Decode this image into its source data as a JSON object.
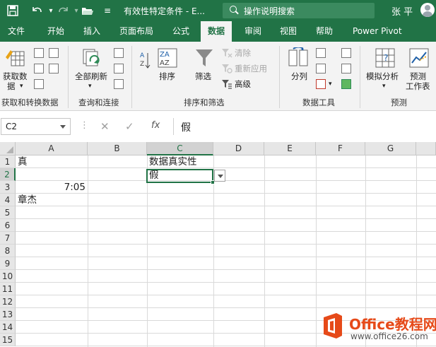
{
  "window": {
    "title": "有效性特定条件 - E...",
    "tell_me": "操作说明搜索",
    "user": "张 平"
  },
  "tabs": [
    {
      "label": "文件"
    },
    {
      "label": "开始"
    },
    {
      "label": "插入"
    },
    {
      "label": "页面布局"
    },
    {
      "label": "公式"
    },
    {
      "label": "数据",
      "active": true
    },
    {
      "label": "审阅"
    },
    {
      "label": "视图"
    },
    {
      "label": "帮助"
    },
    {
      "label": "Power Pivot"
    }
  ],
  "ribbon": {
    "get_data": {
      "label1": "获取数",
      "label2": "据"
    },
    "refresh_all": {
      "label": "全部刷新"
    },
    "sort": {
      "label": "排序"
    },
    "filter": {
      "label": "筛选"
    },
    "clear": {
      "label": "清除"
    },
    "reapply": {
      "label": "重新应用"
    },
    "advanced": {
      "label": "高级"
    },
    "text_to_columns": {
      "label": "分列"
    },
    "what_if": {
      "label": "模拟分析"
    },
    "forecast": {
      "label1": "预测",
      "label2": "工作表"
    },
    "groups": {
      "get_transform": "获取和转换数据",
      "queries": "查询和连接",
      "sort_filter": "排序和筛选",
      "data_tools": "数据工具",
      "forecast": "预测"
    }
  },
  "formula_bar": {
    "name_box": "C2",
    "content": "假"
  },
  "grid": {
    "columns": [
      "A",
      "B",
      "C",
      "D",
      "E",
      "F",
      "G"
    ],
    "rows": [
      "1",
      "2",
      "3",
      "4",
      "5",
      "6",
      "7",
      "8",
      "9",
      "10",
      "11",
      "12",
      "13",
      "14",
      "15"
    ],
    "cells": {
      "A1": "真",
      "C1": "数据真实性",
      "C2": "假",
      "A3": "7:05",
      "A4": "章杰"
    }
  },
  "watermark": {
    "brand": "Office教程网",
    "url": "www.office26.com"
  },
  "colors": {
    "accent": "#217346",
    "watermark": "#e64a19"
  }
}
